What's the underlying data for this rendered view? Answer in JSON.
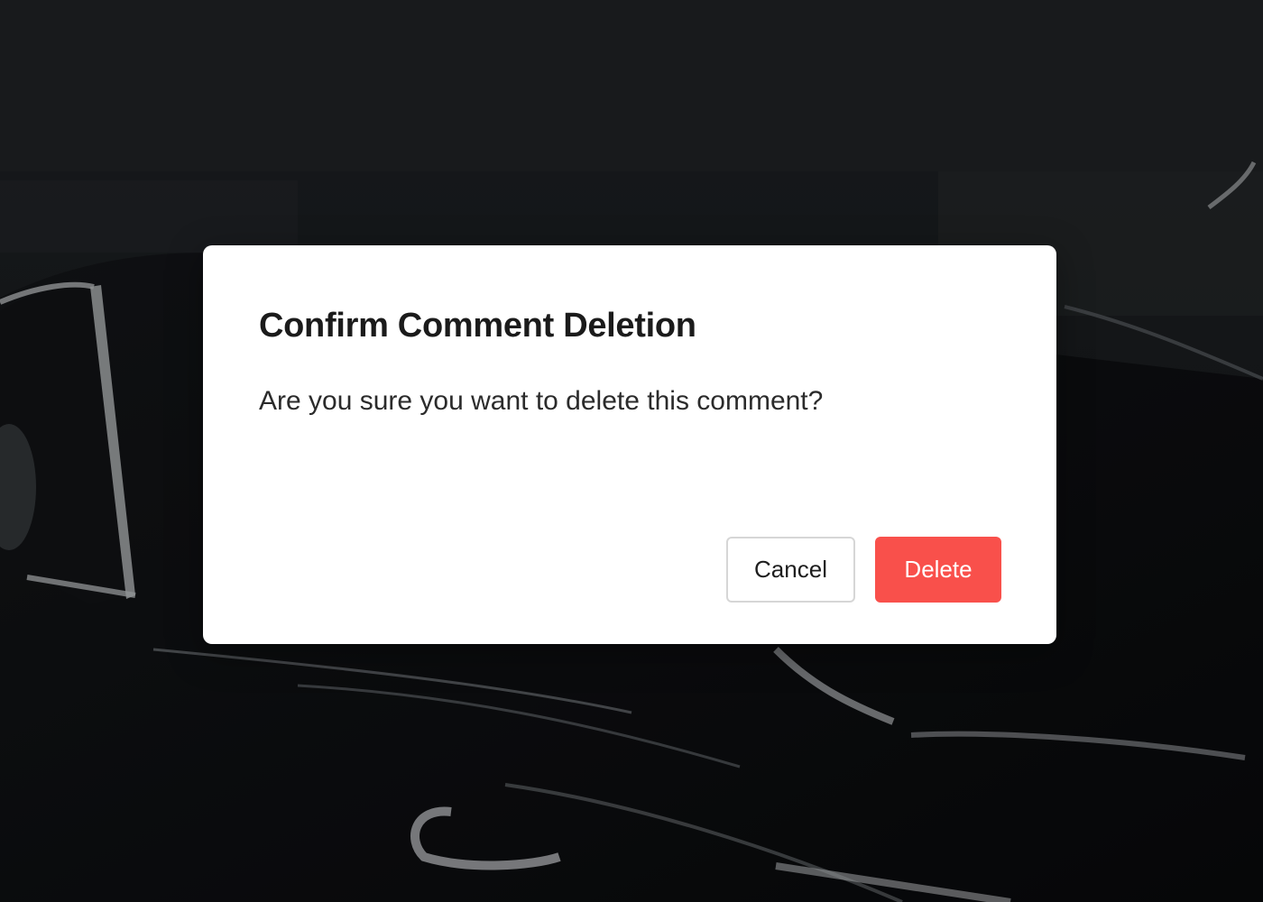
{
  "dialog": {
    "title": "Confirm Comment Deletion",
    "message": "Are you sure you want to delete this comment?",
    "cancel_label": "Cancel",
    "delete_label": "Delete"
  },
  "colors": {
    "delete_button": "#f9504b",
    "dialog_background": "#ffffff",
    "backdrop": "#1a1c1e"
  },
  "background": {
    "description_icon": "car-photo-backdrop"
  }
}
